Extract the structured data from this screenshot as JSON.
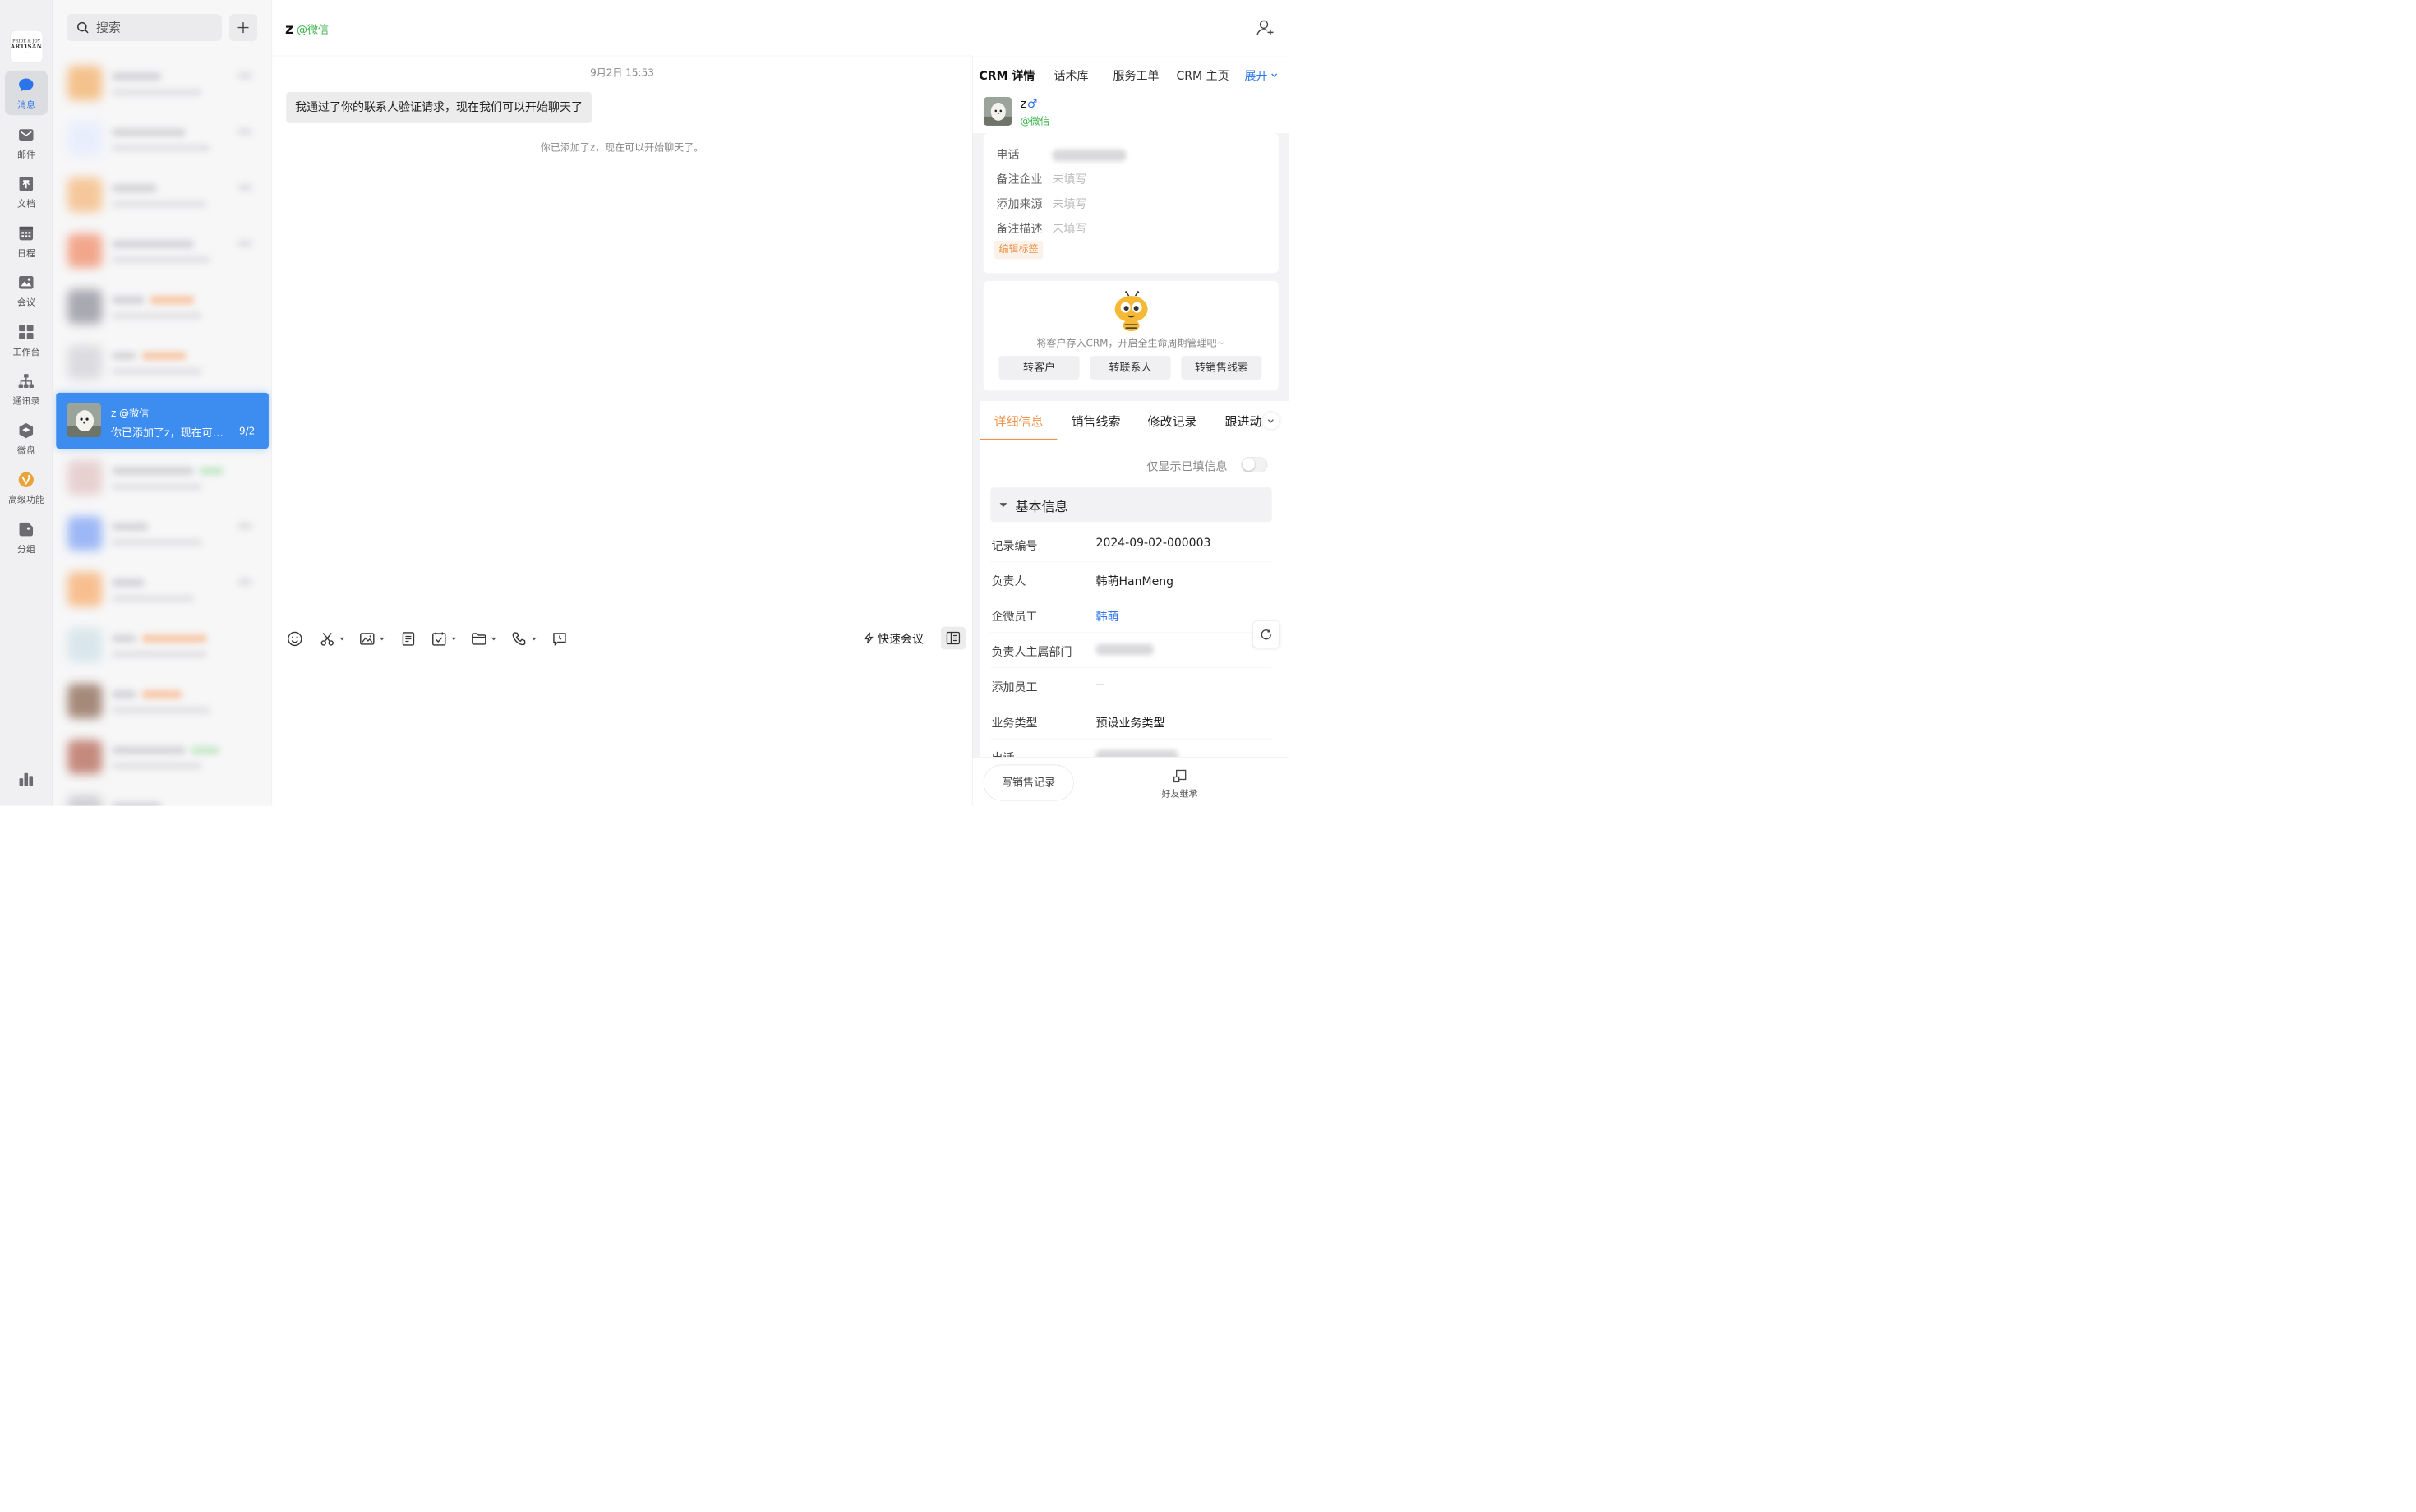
{
  "nav": {
    "logo": {
      "line1": "PRIDE & JOY",
      "line2": "ARTISAN",
      "line3": "· · ·"
    },
    "items": [
      {
        "label": "消息",
        "icon": "message-icon",
        "active": true
      },
      {
        "label": "邮件",
        "icon": "mail-icon"
      },
      {
        "label": "文档",
        "icon": "document-icon"
      },
      {
        "label": "日程",
        "icon": "calendar-icon"
      },
      {
        "label": "会议",
        "icon": "meeting-icon"
      },
      {
        "label": "工作台",
        "icon": "workbench-icon"
      },
      {
        "label": "通讯录",
        "icon": "contacts-icon"
      },
      {
        "label": "微盘",
        "icon": "drive-icon"
      },
      {
        "label": "高级功能",
        "icon": "premium-icon"
      },
      {
        "label": "分组",
        "icon": "group-tag-icon"
      }
    ],
    "bottom_icon": "stats-icon"
  },
  "list": {
    "search_placeholder": "搜索",
    "selected": {
      "name": "z",
      "source": "@微信",
      "message": "你已添加了z，现在可以开始聊天了。",
      "date": "9/2"
    }
  },
  "chat": {
    "title": "z",
    "source": "@微信",
    "time": "9月2日 15:53",
    "bubble": "我通过了你的联系人验证请求，现在我们可以开始聊天了",
    "system": "你已添加了z，现在可以开始聊天了。",
    "quick_meeting": "快速会议"
  },
  "crm": {
    "tabs": [
      "CRM 详情",
      "话术库",
      "服务工单",
      "CRM 主页"
    ],
    "expand": "展开",
    "contact": {
      "name": "z",
      "gender": "♂",
      "source": "@微信"
    },
    "fields": [
      {
        "key": "电话",
        "value": ""
      },
      {
        "key": "备注企业",
        "value": "未填写"
      },
      {
        "key": "添加来源",
        "value": "未填写"
      },
      {
        "key": "备注描述",
        "value": "未填写"
      }
    ],
    "edit_tag": "编辑标签",
    "tip": "将客户存入CRM，开启全生命周期管理吧~",
    "buttons": [
      "转客户",
      "转联系人",
      "转销售线索"
    ],
    "detail_tabs": [
      "详细信息",
      "销售线索",
      "修改记录",
      "跟进动"
    ],
    "toggle_label": "仅显示已填信息",
    "section": "基本信息",
    "detail_rows": [
      {
        "key": "记录编号",
        "value": "2024-09-02-000003"
      },
      {
        "key": "负责人",
        "value": "韩萌HanMeng"
      },
      {
        "key": "企微员工",
        "value": "韩萌"
      },
      {
        "key": "负责人主属部门",
        "value": ""
      },
      {
        "key": "添加员工",
        "value": "--"
      },
      {
        "key": "业务类型",
        "value": "预设业务类型"
      },
      {
        "key": "电话",
        "value": ""
      }
    ],
    "write_record": "写销售记录",
    "inherit": "好友继承"
  },
  "colors": {
    "accent": "#2b74ea",
    "selected": "#3d8cf0",
    "wechat_green": "#3cb24a",
    "orange": "#f0924a"
  }
}
